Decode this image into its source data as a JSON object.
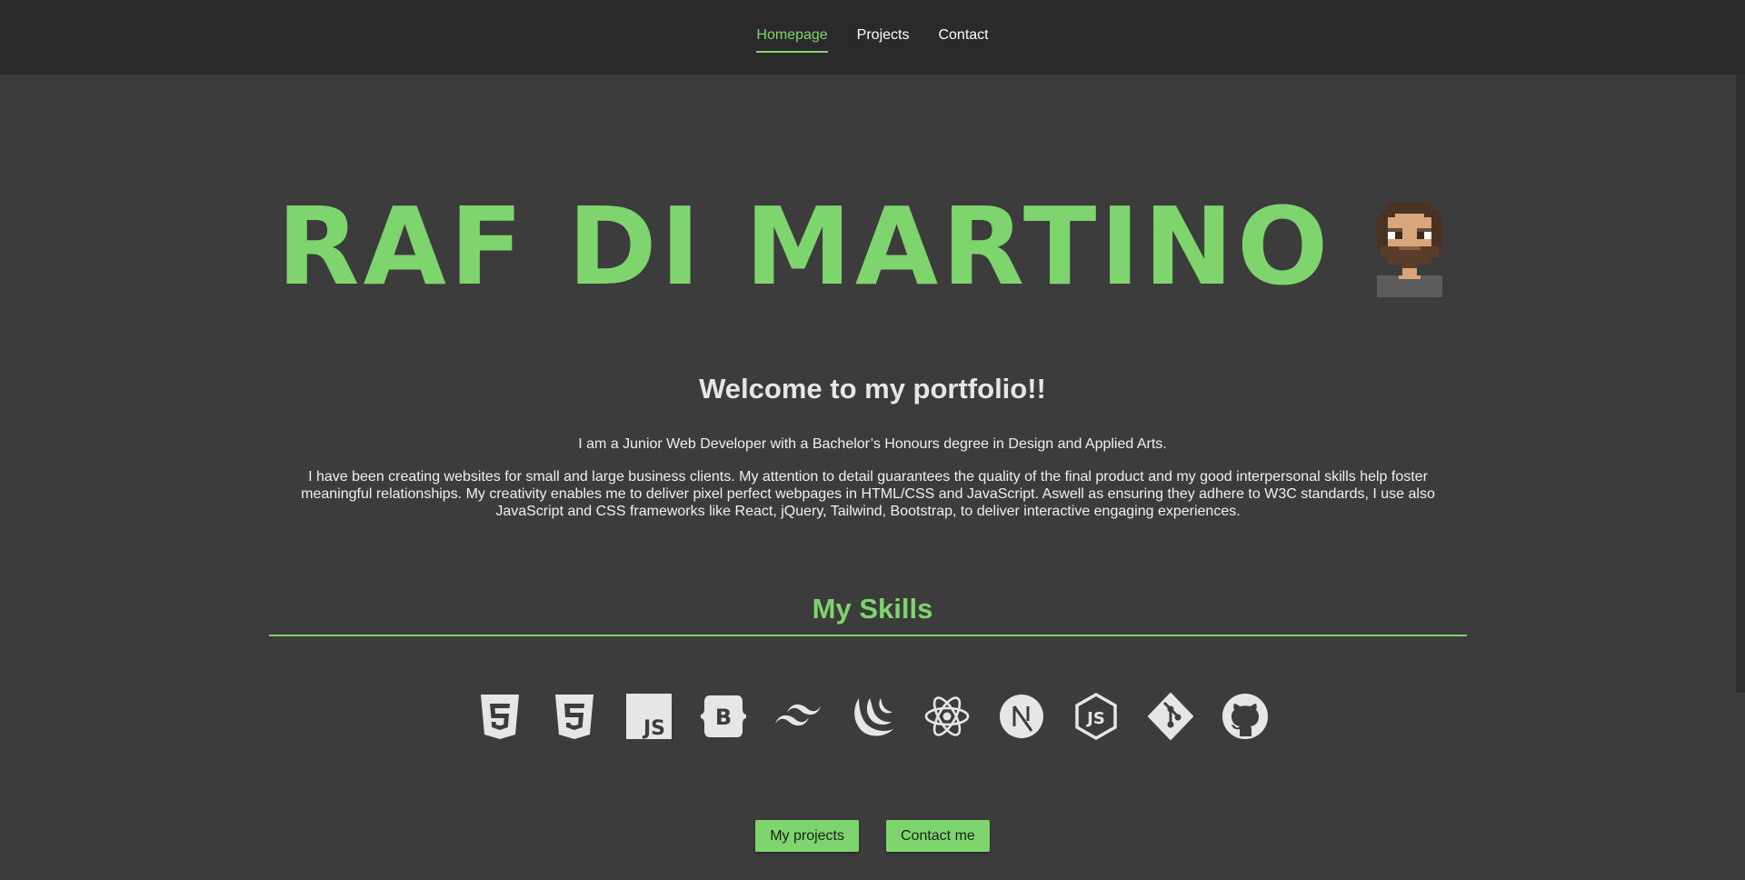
{
  "nav": {
    "items": [
      {
        "label": "Homepage",
        "active": true
      },
      {
        "label": "Projects",
        "active": false
      },
      {
        "label": "Contact",
        "active": false
      }
    ]
  },
  "hero": {
    "title": "RAF DI MARTINO",
    "avatar_icon": "pixel-art-avatar-icon"
  },
  "welcome": "Welcome to my portfolio!!",
  "intro": "I am a Junior Web Developer with a Bachelor’s Honours degree in Design and Applied Arts.",
  "bio": "I have been creating websites for small and large business clients. My attention to detail guarantees the quality of the final product and my good interpersonal skills help foster meaningful relationships. My creativity enables me to deliver pixel perfect webpages in HTML/CSS and JavaScript. Aswell as ensuring they adhere to W3C standards, I use also JavaScript and CSS frameworks like React, jQuery, Tailwind, Bootstrap, to deliver interactive engaging experiences.",
  "skills": {
    "title": "My Skills",
    "icons": [
      "html5-icon",
      "css3-icon",
      "javascript-icon",
      "bootstrap-icon",
      "tailwind-icon",
      "jquery-icon",
      "react-icon",
      "nextjs-icon",
      "nodejs-icon",
      "git-icon",
      "github-icon"
    ]
  },
  "buttons": {
    "projects": "My projects",
    "contact": "Contact me"
  },
  "colors": {
    "accent": "#7ed56e",
    "background": "#3c3c3c",
    "navbar": "#2a2a2a",
    "icon": "#e6e6e6"
  }
}
